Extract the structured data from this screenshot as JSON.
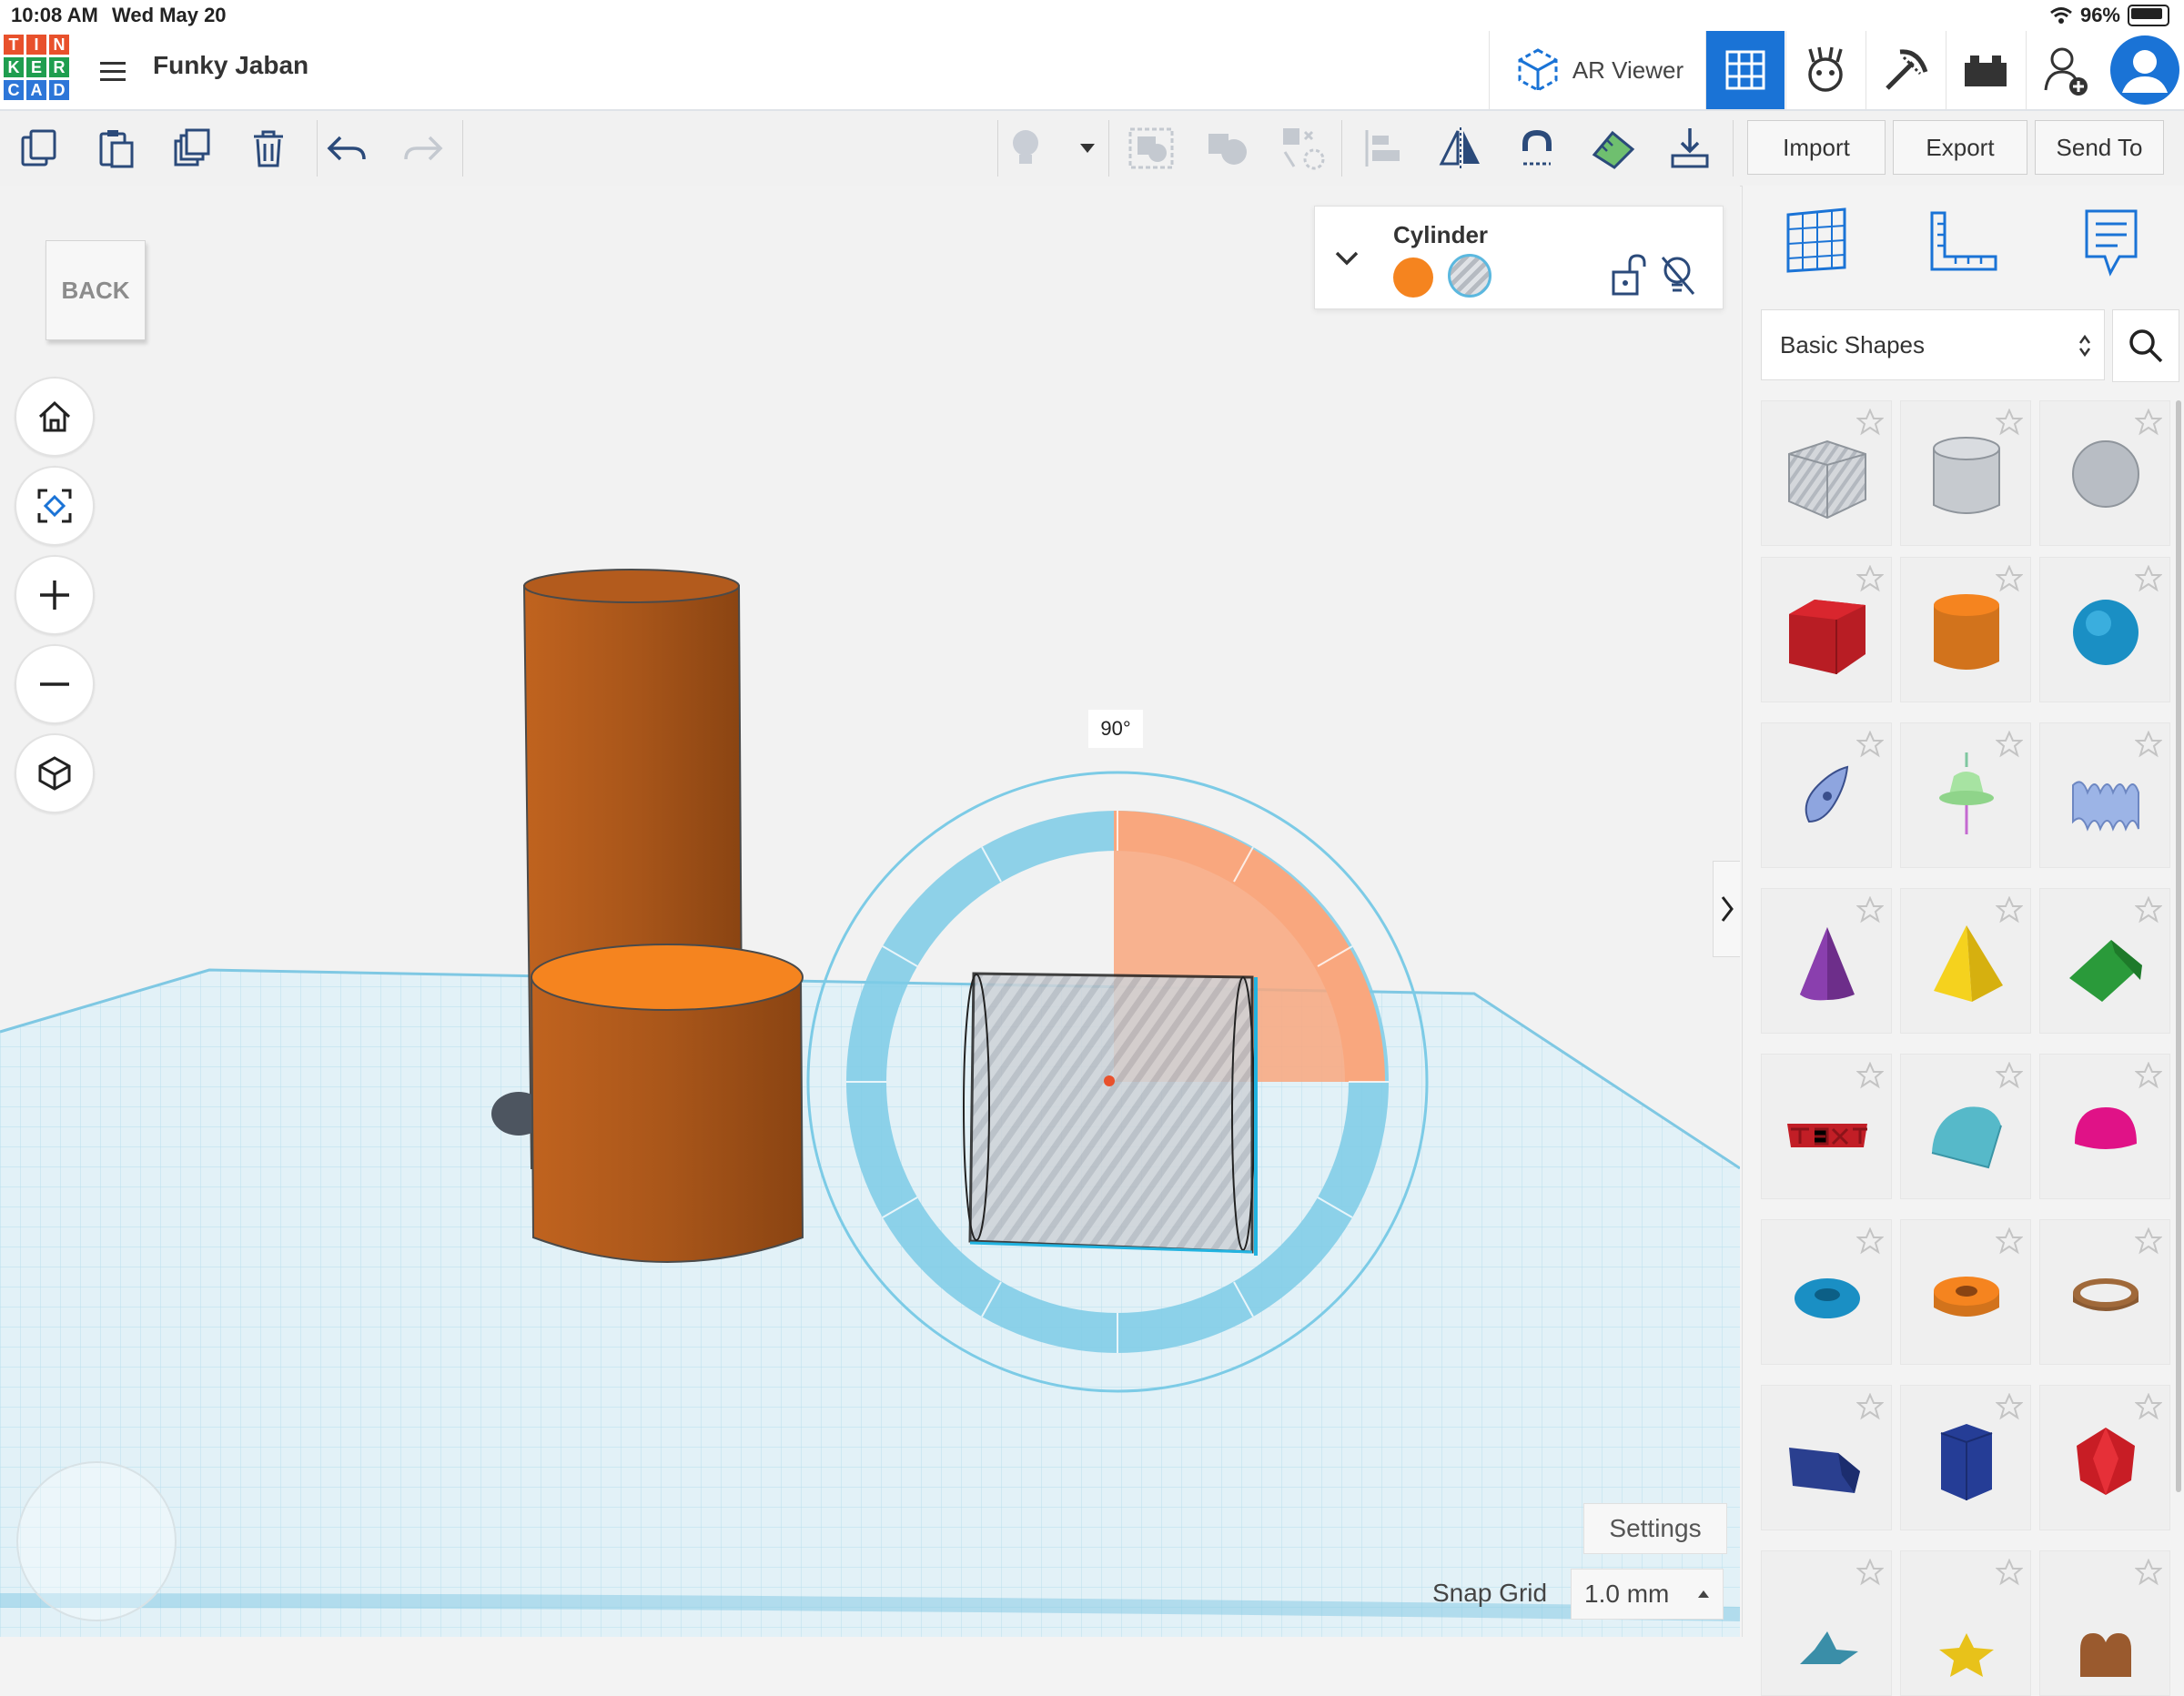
{
  "status_bar": {
    "time": "10:08 AM",
    "date": "Wed May 20",
    "battery": "96%"
  },
  "header": {
    "logo_letters": [
      "T",
      "I",
      "N",
      "K",
      "E",
      "R",
      "C",
      "A",
      "D"
    ],
    "logo_colors": [
      "#e8512c",
      "#e8512c",
      "#e8512c",
      "#1f9e4f",
      "#1f9e4f",
      "#1f9e4f",
      "#2d76d8",
      "#2d76d8",
      "#2d76d8"
    ],
    "project_title": "Funky Jaban",
    "ar_viewer_label": "AR Viewer"
  },
  "toolbar": {
    "import_label": "Import",
    "export_label": "Export",
    "send_to_label": "Send To"
  },
  "workplane": {
    "back_label": "BACK",
    "rotation_label": "90°",
    "settings_label": "Settings",
    "snap_grid_label": "Snap Grid",
    "snap_grid_value": "1.0 mm"
  },
  "inspector": {
    "shape_name": "Cylinder",
    "solid_color": "#f5841f"
  },
  "shape_panel": {
    "category": "Basic Shapes",
    "shapes": [
      "Box Hole",
      "Cylinder Hole",
      "Sphere Hole",
      "Box",
      "Cylinder",
      "Sphere",
      "Scribble",
      "Shape Generator",
      "Text Wave",
      "Cone",
      "Pyramid",
      "Roof",
      "Text",
      "Round Roof",
      "Half Sphere",
      "Torus",
      "Tube",
      "Ring",
      "Wedge",
      "Polygon",
      "Icosahedron",
      "Star",
      "Star Pyramid",
      "Heart"
    ]
  },
  "colors": {
    "accent": "#1a73d6",
    "orange": "#b65a19",
    "selection": "#5bb8df"
  }
}
